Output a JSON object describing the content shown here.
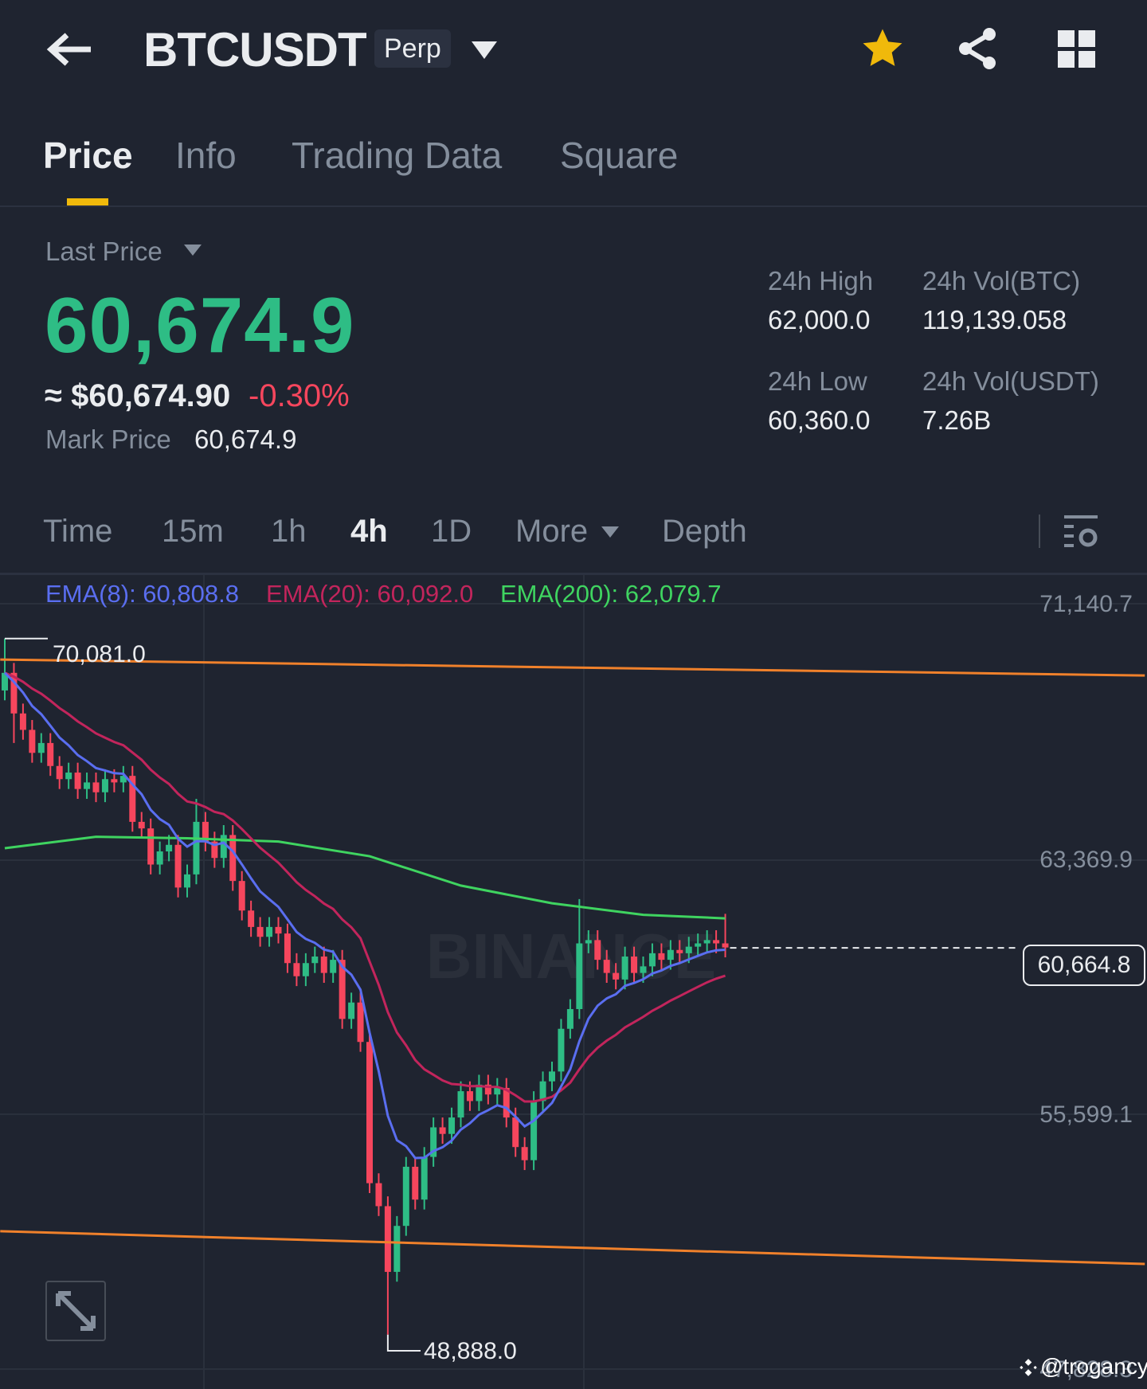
{
  "header": {
    "title": "BTCUSDT",
    "badge": "Perp"
  },
  "tabs": [
    {
      "label": "Price"
    },
    {
      "label": "Info"
    },
    {
      "label": "Trading Data"
    },
    {
      "label": "Square"
    }
  ],
  "ticker": {
    "last_price_label": "Last Price",
    "last_price": "60,674.9",
    "usd_price": "≈ $60,674.90",
    "change": "-0.30%",
    "mark_price_label": "Mark Price",
    "mark_price": "60,674.9",
    "high_label": "24h High",
    "high": "62,000.0",
    "low_label": "24h Low",
    "low": "60,360.0",
    "vol_btc_label": "24h Vol(BTC)",
    "vol_btc": "119,139.058",
    "vol_usdt_label": "24h Vol(USDT)",
    "vol_usdt": "7.26B"
  },
  "intervals": [
    {
      "label": "Time"
    },
    {
      "label": "15m"
    },
    {
      "label": "1h"
    },
    {
      "label": "4h"
    },
    {
      "label": "1D"
    },
    {
      "label": "More"
    },
    {
      "label": "Depth"
    }
  ],
  "ema_legend": {
    "ema8": "EMA(8): 60,808.8",
    "ema20": "EMA(20): 60,092.0",
    "ema200": "EMA(200): 62,079.7"
  },
  "colors": {
    "up": "#2ebd85",
    "down": "#f6465d",
    "accent": "#f0b90b",
    "ema8": "#5a6ef0",
    "ema20": "#c2255c",
    "ema200": "#3fd460",
    "trend": "#f0812b"
  },
  "watermark": "BINANCE",
  "credit": "@trogancy",
  "chart_data": {
    "type": "candlestick",
    "y_ticks": [
      "71,140.7",
      "63,369.9",
      "55,599.1",
      "47,828.3"
    ],
    "ylim": [
      47828.3,
      71140.7
    ],
    "first_open": 68500,
    "closes": [
      69036,
      67800,
      67300,
      66600,
      66900,
      66200,
      65800,
      66000,
      65500,
      65700,
      65400,
      65800,
      65700,
      65900,
      64500,
      64300,
      63200,
      63600,
      63800,
      62500,
      62900,
      64500,
      63900,
      63400,
      64100,
      62700,
      61800,
      61300,
      61000,
      61300,
      61100,
      60200,
      59800,
      60200,
      60400,
      59900,
      60300,
      58500,
      59000,
      57800,
      53500,
      52800,
      50800,
      52200,
      54000,
      53000,
      54300,
      55200,
      55000,
      55500,
      56300,
      56000,
      56500,
      56200,
      56400,
      55500,
      54600,
      54200,
      56000,
      56600,
      56900,
      58200,
      58800,
      60800,
      60900,
      60300,
      59900,
      59700,
      60400,
      59900,
      60100,
      60500,
      60300,
      60600,
      60500,
      60700,
      60800,
      60900,
      60800,
      60675
    ],
    "wick_extremes": {
      "0": {
        "high": 70081
      },
      "1": {
        "low": 66900
      },
      "21": {
        "high": 65200
      },
      "42": {
        "low": 48888
      },
      "63": {
        "high": 62150
      },
      "79": {
        "high": 61700
      }
    },
    "ema200": [
      63696,
      64046,
      64000,
      63900,
      63453,
      62560,
      62021,
      61670,
      61562
    ],
    "high_label": "70,081.0",
    "low_label": "48,888.0",
    "current_price": "60,664.8",
    "current_value": 60664.8,
    "trendlines": [
      {
        "from": [
          -0.5,
          69441
        ],
        "to": [
          125,
          68955
        ]
      },
      {
        "from": [
          -0.5,
          52039
        ],
        "to": [
          125,
          51041
        ]
      }
    ]
  }
}
